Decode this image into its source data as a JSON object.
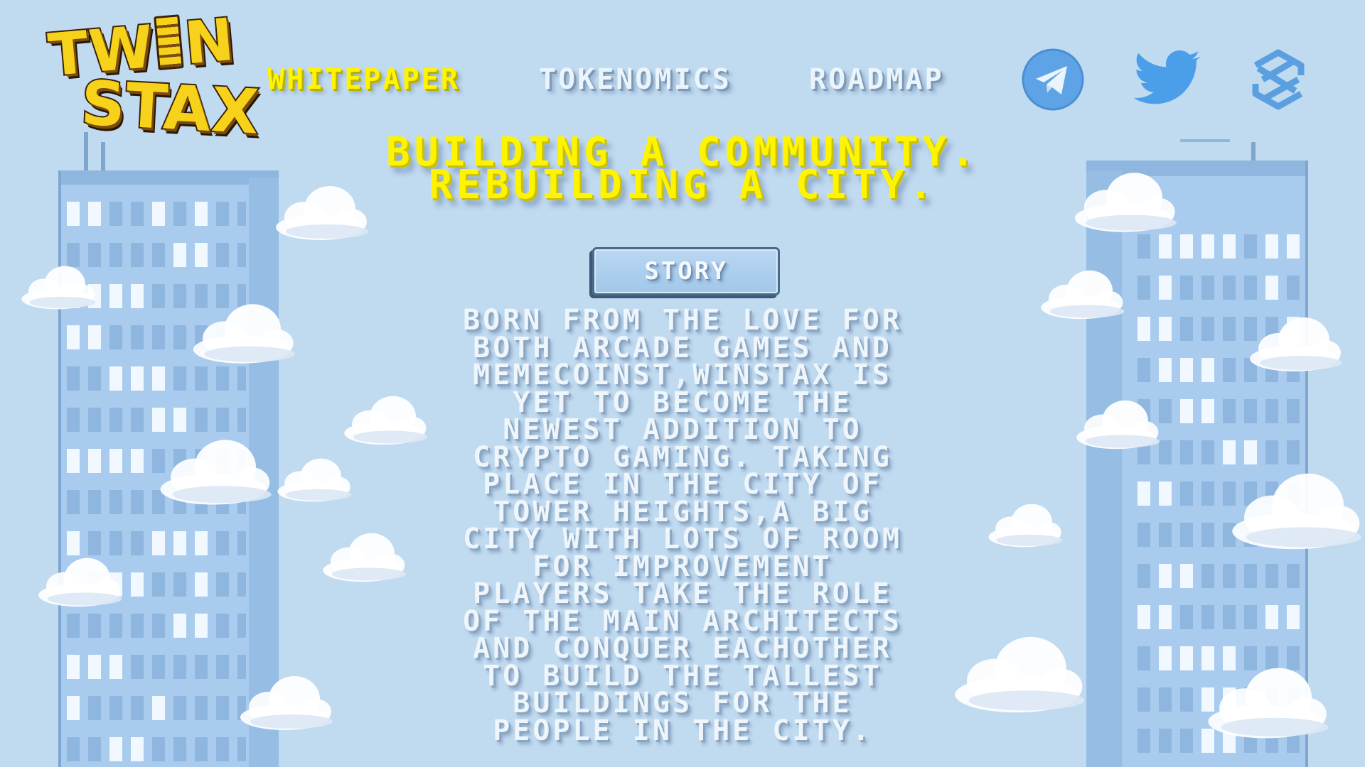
{
  "logo": {
    "line1_a": "TW",
    "line1_b": "N",
    "line2": "STAX"
  },
  "nav": {
    "whitepaper": "WHITEPAPER",
    "tokenomics": "TOKENOMICS",
    "roadmap": "ROADMAP"
  },
  "social": {
    "telegram_icon": "telegram-icon",
    "twitter_icon": "twitter-icon",
    "dex_icon": "dextools-icon"
  },
  "headline": {
    "line1": "BUILDING A COMMUNITY.",
    "line2": "REBUILDING A CITY."
  },
  "story": {
    "button_label": "STORY",
    "lines": [
      "BORN FROM THE LOVE FOR",
      "BOTH ARCADE GAMES AND",
      "MEMECOINST,WINSTAX IS",
      "YET TO BECOME THE",
      "NEWEST ADDITION TO",
      "CRYPTO GAMING. TAKING",
      "PLACE IN THE CITY OF",
      "TOWER HEIGHTS,A BIG",
      "CITY WITH LOTS OF ROOM",
      "FOR IMPROVEMENT",
      "PLAYERS TAKE THE ROLE",
      "OF THE MAIN ARCHITECTS",
      "AND CONQUER EACHOTHER",
      "TO BUILD THE TALLEST",
      "BUILDINGS FOR THE",
      "PEOPLE IN THE CITY."
    ]
  },
  "colors": {
    "sky": "#c0daf0",
    "accent_yellow": "#fff400",
    "building": "#a9cbee",
    "window": "#f2f8ff"
  }
}
